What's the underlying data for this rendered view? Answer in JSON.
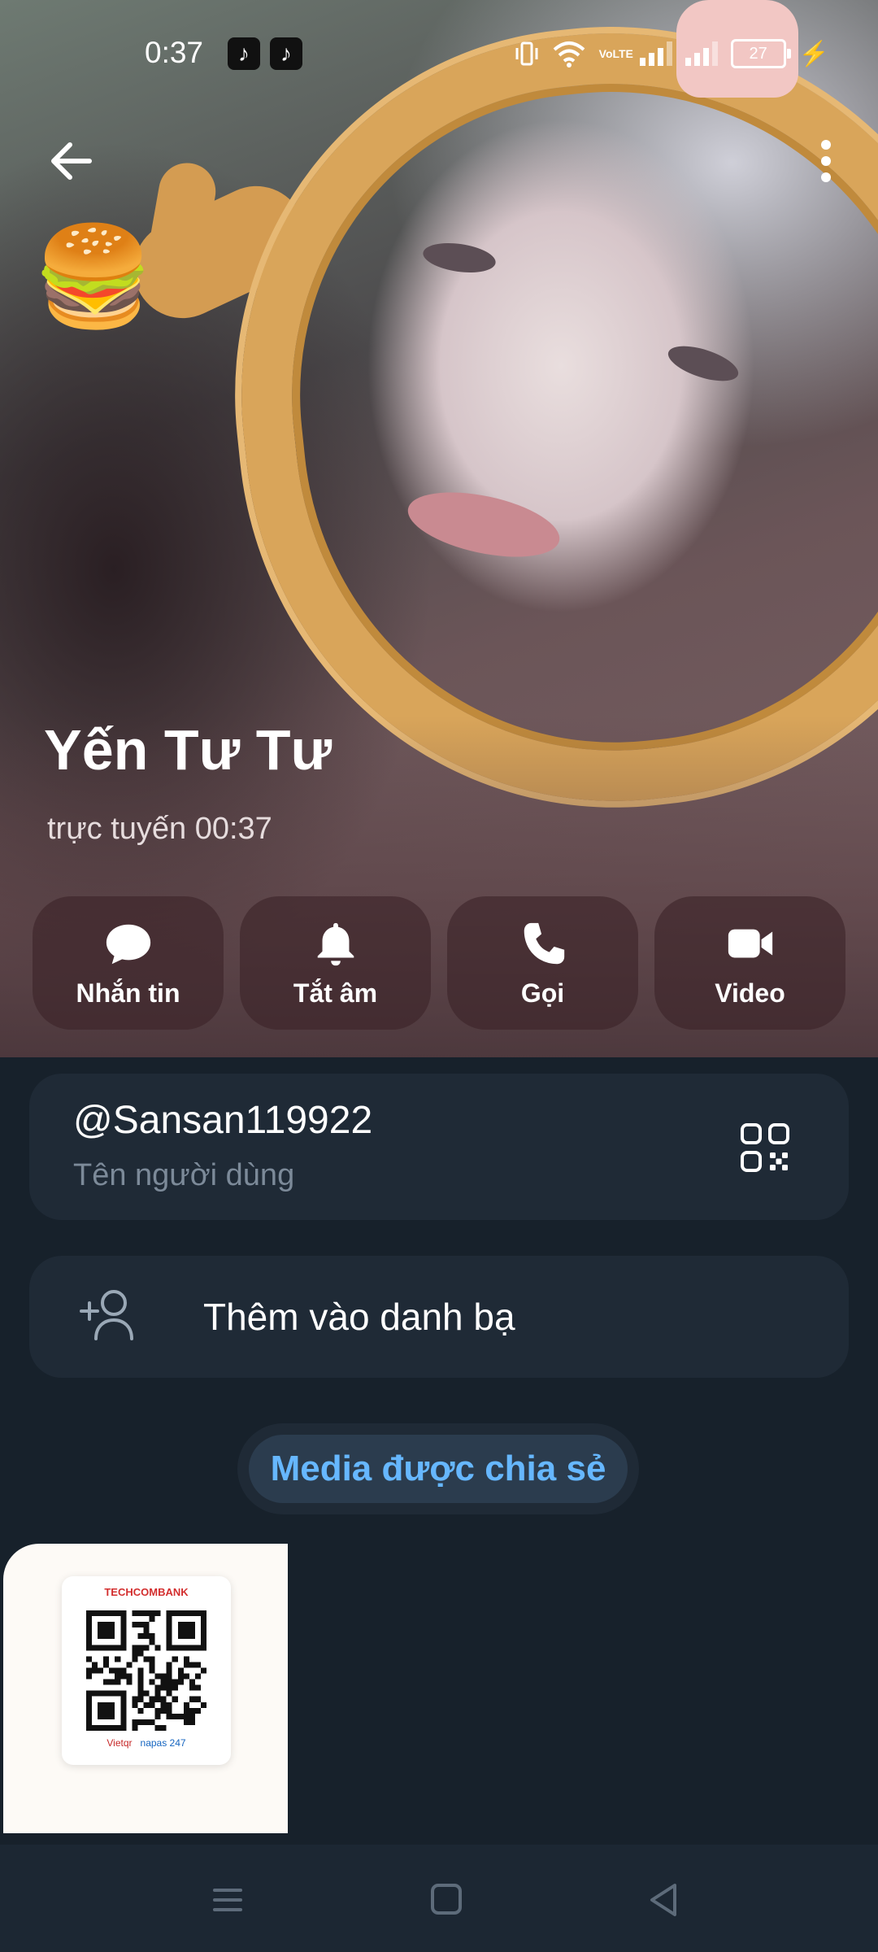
{
  "status_bar": {
    "time": "0:37",
    "battery": "27",
    "network_label": "VoLTE"
  },
  "profile": {
    "name": "Yến Tư Tư",
    "status": "trực tuyến 00:37"
  },
  "actions": [
    {
      "label": "Nhắn tin",
      "icon": "chat-bubble-icon"
    },
    {
      "label": "Tắt âm",
      "icon": "bell-icon"
    },
    {
      "label": "Gọi",
      "icon": "phone-icon"
    },
    {
      "label": "Video",
      "icon": "video-camera-icon"
    }
  ],
  "username": {
    "value": "@Sansan119922",
    "caption": "Tên người dùng"
  },
  "contact": {
    "label": "Thêm vào danh bạ"
  },
  "shared_media": {
    "label": "Media được chia sẻ",
    "thumbnail": {
      "bank": "TECHCOMBANK",
      "footer_left": "Vietqr",
      "footer_right": "napas 247"
    }
  },
  "colors": {
    "background": "#17212b",
    "card": "#1f2a36",
    "accent_link": "#66b7ff"
  }
}
